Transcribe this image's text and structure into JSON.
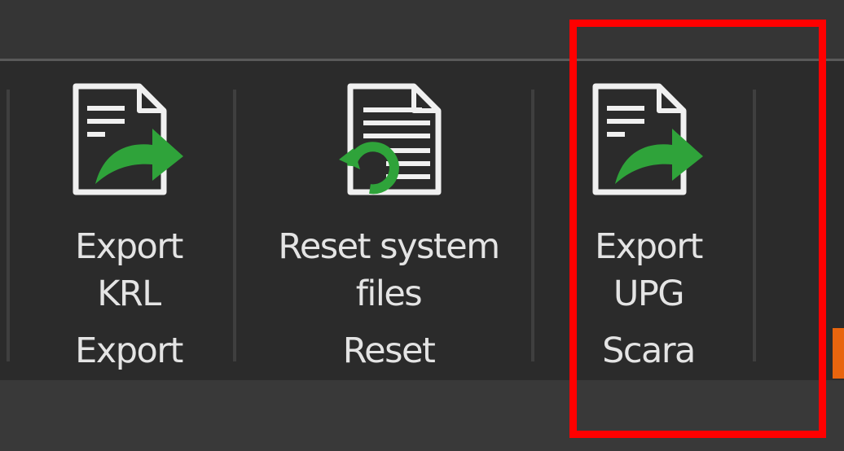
{
  "ribbon": {
    "buttons": [
      {
        "line1": "Export",
        "line2": "KRL",
        "icon": "export-document-icon"
      },
      {
        "line1": "Reset system",
        "line2": "files",
        "icon": "reset-document-icon"
      },
      {
        "line1": "Export",
        "line2": "UPG",
        "icon": "export-document-icon"
      }
    ],
    "groups": [
      "Export",
      "Reset",
      "Scara"
    ]
  },
  "colors": {
    "background": "#2b2b2b",
    "text": "#e4e4e4",
    "icon_outline": "#f0f0f0",
    "accent_green": "#2fa33a",
    "highlight": "#ff0000",
    "orange_tab": "#e8650e"
  }
}
